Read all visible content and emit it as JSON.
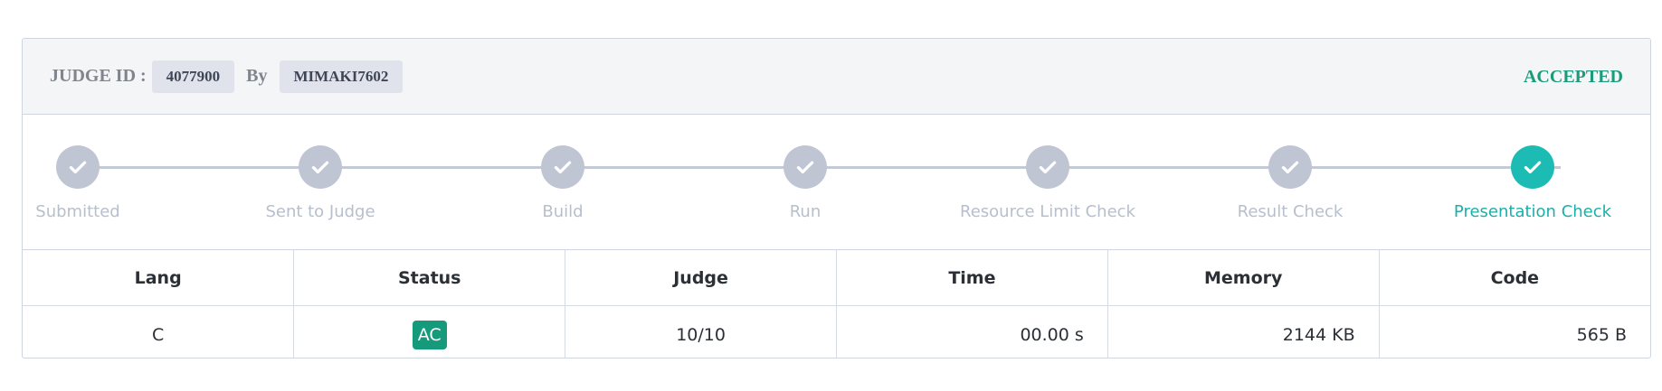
{
  "header": {
    "judge_id_label": "JUDGE ID :",
    "judge_id": "4077900",
    "by_label": "By",
    "user": "MIMAKI7602",
    "verdict": "ACCEPTED",
    "verdict_color": "#1a9c7b"
  },
  "steps": [
    {
      "label": "Submitted",
      "state": "done"
    },
    {
      "label": "Sent to Judge",
      "state": "done"
    },
    {
      "label": "Build",
      "state": "done"
    },
    {
      "label": "Run",
      "state": "done"
    },
    {
      "label": "Resource Limit Check",
      "state": "done"
    },
    {
      "label": "Result Check",
      "state": "done"
    },
    {
      "label": "Presentation Check",
      "state": "active"
    }
  ],
  "colors": {
    "step_done": "#bfc5d3",
    "step_active": "#1cbcb5",
    "badge_ac": "#159a7c"
  },
  "table": {
    "headers": [
      "Lang",
      "Status",
      "Judge",
      "Time",
      "Memory",
      "Code"
    ],
    "row": {
      "lang": "C",
      "status": "AC",
      "judge": "10/10",
      "time": "00.00 s",
      "memory": "2144 KB",
      "code": "565 B"
    }
  }
}
